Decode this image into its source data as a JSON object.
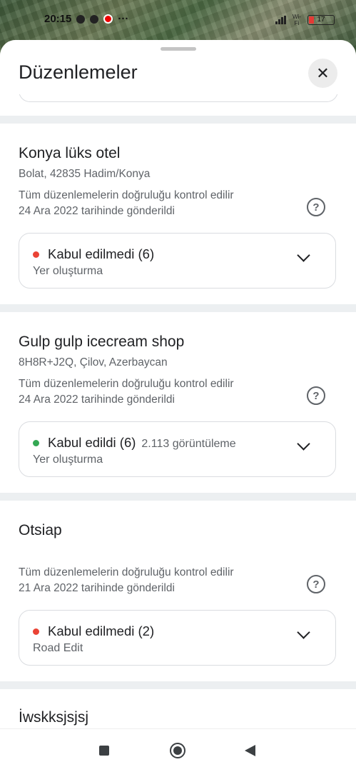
{
  "status_bar": {
    "time": "20:15",
    "wifi_label": "Wi-Fi",
    "battery": "17"
  },
  "sheet": {
    "title": "Düzenlemeler",
    "close_icon": "close-icon"
  },
  "entries": [
    {
      "name": "Konya lüks otel",
      "address": "Bolat, 42835 Hadim/Konya",
      "note_line1": "Tüm düzenlemelerin doğruluğu kontrol edilir",
      "note_line2": "24 Ara 2022 tarihinde gönderildi",
      "status": "Kabul edilmedi (6)",
      "status_color": "#ea4335",
      "views": "",
      "type": "Yer oluşturma"
    },
    {
      "name": "Gulp gulp icecream shop",
      "address": "8H8R+J2Q, Çilov, Azerbaycan",
      "note_line1": "Tüm düzenlemelerin doğruluğu kontrol edilir",
      "note_line2": "24 Ara 2022 tarihinde gönderildi",
      "status": "Kabul edildi (6)",
      "status_color": "#34a853",
      "views": "2.113 görüntüleme",
      "type": "Yer oluşturma"
    },
    {
      "name": "Otsiap",
      "address": "",
      "note_line1": "Tüm düzenlemelerin doğruluğu kontrol edilir",
      "note_line2": "21 Ara 2022 tarihinde gönderildi",
      "status": "Kabul edilmedi (2)",
      "status_color": "#ea4335",
      "views": "",
      "type": "Road Edit"
    },
    {
      "name": "İwskksjsjsj"
    }
  ],
  "nav": {
    "recents_icon": "square-icon",
    "home_icon": "circle-icon",
    "back_icon": "triangle-back-icon"
  }
}
